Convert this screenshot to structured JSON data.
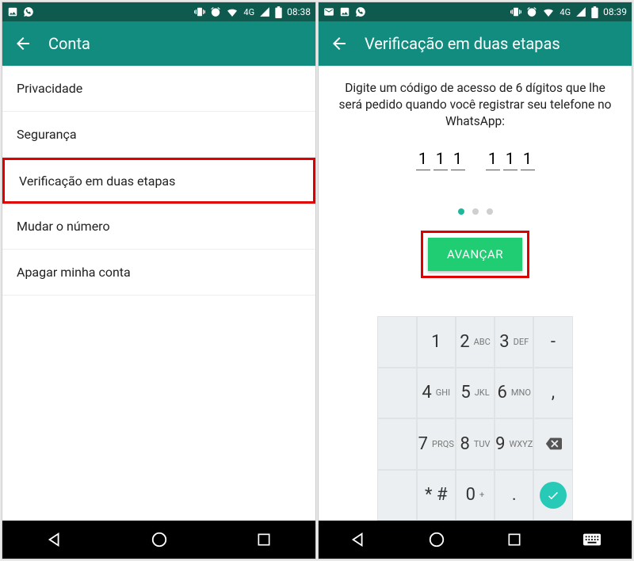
{
  "colors": {
    "primary": "#128C7E",
    "primaryDark": "#0e5a4f",
    "accent": "#20cd72",
    "highlight": "#e10000",
    "keypad": "#eceff1",
    "ok": "#27c9b7"
  },
  "left": {
    "status": {
      "time": "08:38",
      "network": "4G"
    },
    "appbar_title": "Conta",
    "items": [
      {
        "label": "Privacidade"
      },
      {
        "label": "Segurança"
      },
      {
        "label": "Verificação em duas etapas",
        "highlighted": true
      },
      {
        "label": "Mudar o número"
      },
      {
        "label": "Apagar minha conta"
      }
    ]
  },
  "right": {
    "status": {
      "time": "08:39",
      "network": "4G"
    },
    "appbar_title": "Verificação em duas etapas",
    "instruction": "Digite um código de acesso de 6 dígitos que lhe será pedido quando você registrar seu telefone no WhatsApp:",
    "pin": [
      "1",
      "1",
      "1",
      "1",
      "1",
      "1"
    ],
    "progress_dots": {
      "total": 3,
      "active": 0
    },
    "advance_label": "AVANÇAR",
    "keypad": [
      [
        {
          "n": "1"
        },
        {
          "n": "2",
          "l": "ABC"
        },
        {
          "n": "3",
          "l": "DEF"
        },
        {
          "sym": "-"
        }
      ],
      [
        {
          "n": "4",
          "l": "GHI"
        },
        {
          "n": "5",
          "l": "JKL"
        },
        {
          "n": "6",
          "l": "MNO"
        },
        {
          "sym": ","
        }
      ],
      [
        {
          "n": "7",
          "l": "PRQS"
        },
        {
          "n": "8",
          "l": "TUV"
        },
        {
          "n": "9",
          "l": "WXYZ"
        },
        {
          "back": true
        }
      ],
      [
        {
          "sym": "* #"
        },
        {
          "n": "0",
          "l": "+"
        },
        {
          "sym": "."
        },
        {
          "ok": true
        }
      ]
    ]
  }
}
